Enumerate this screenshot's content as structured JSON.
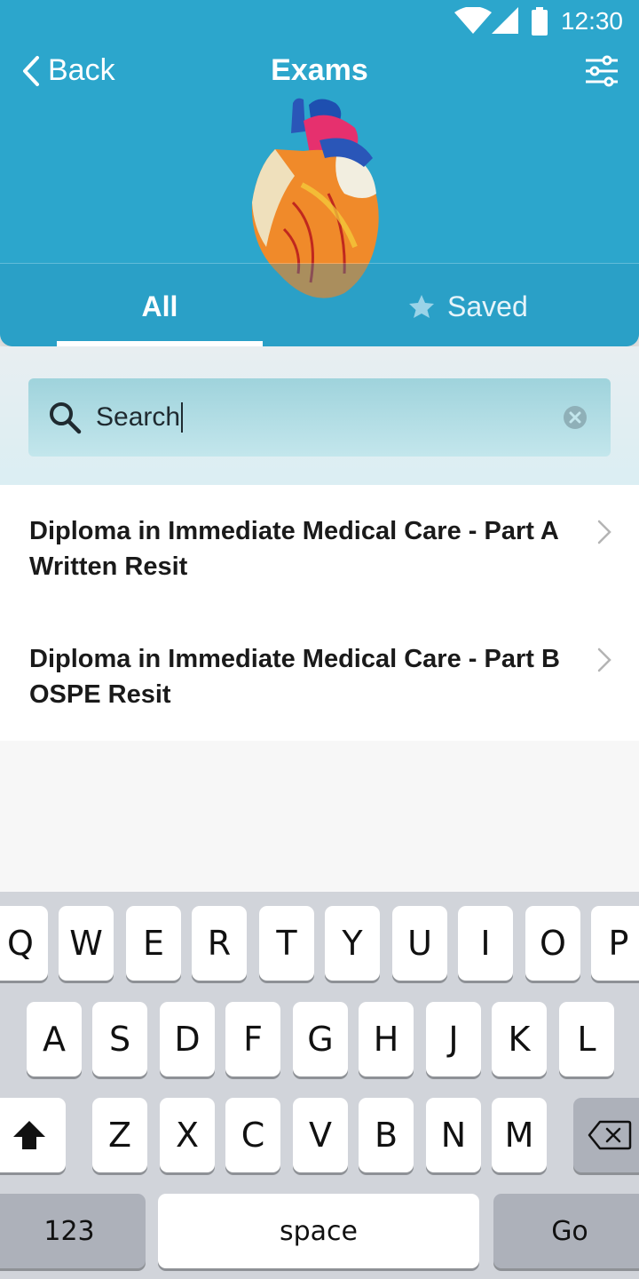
{
  "status_bar": {
    "time": "12:30"
  },
  "nav": {
    "back_label": "Back",
    "title": "Exams"
  },
  "tabs": [
    {
      "label": "All",
      "selected": true
    },
    {
      "label": "Saved",
      "selected": false
    }
  ],
  "search": {
    "value": "Search"
  },
  "exams": [
    {
      "title": "Diploma in Immediate Medical Care - Part A Written Resit"
    },
    {
      "title": "Diploma in Immediate Medical Care - Part B OSPE Resit"
    }
  ],
  "keyboard": {
    "row1": [
      "Q",
      "W",
      "E",
      "R",
      "T",
      "Y",
      "U",
      "I",
      "O",
      "P"
    ],
    "row2": [
      "A",
      "S",
      "D",
      "F",
      "G",
      "H",
      "J",
      "K",
      "L"
    ],
    "row3": [
      "Z",
      "X",
      "C",
      "V",
      "B",
      "N",
      "M"
    ],
    "numbers_label": "123",
    "space_label": "space",
    "go_label": "Go"
  },
  "colors": {
    "header": "#2ca6cc",
    "accent_white": "#ffffff",
    "keyboard_bg": "#d1d4da"
  }
}
